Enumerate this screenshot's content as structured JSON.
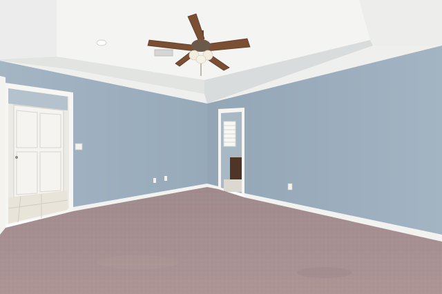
{
  "scene": {
    "subject": "empty-bedroom-interior",
    "colors": {
      "wall": "#9fb1c0",
      "wall_shadow": "#8fa2b2",
      "ceiling": "#f1f2f0",
      "tray_ceiling": "#e9ebea",
      "carpet": "#a89293",
      "baseboard": "#f2f2f0",
      "door": "#f5f4f0",
      "tile": "#e8e4da",
      "fan_blade": "#7a4f34",
      "fan_body": "#6b5a4a",
      "fan_light": "#f3ede0"
    }
  }
}
